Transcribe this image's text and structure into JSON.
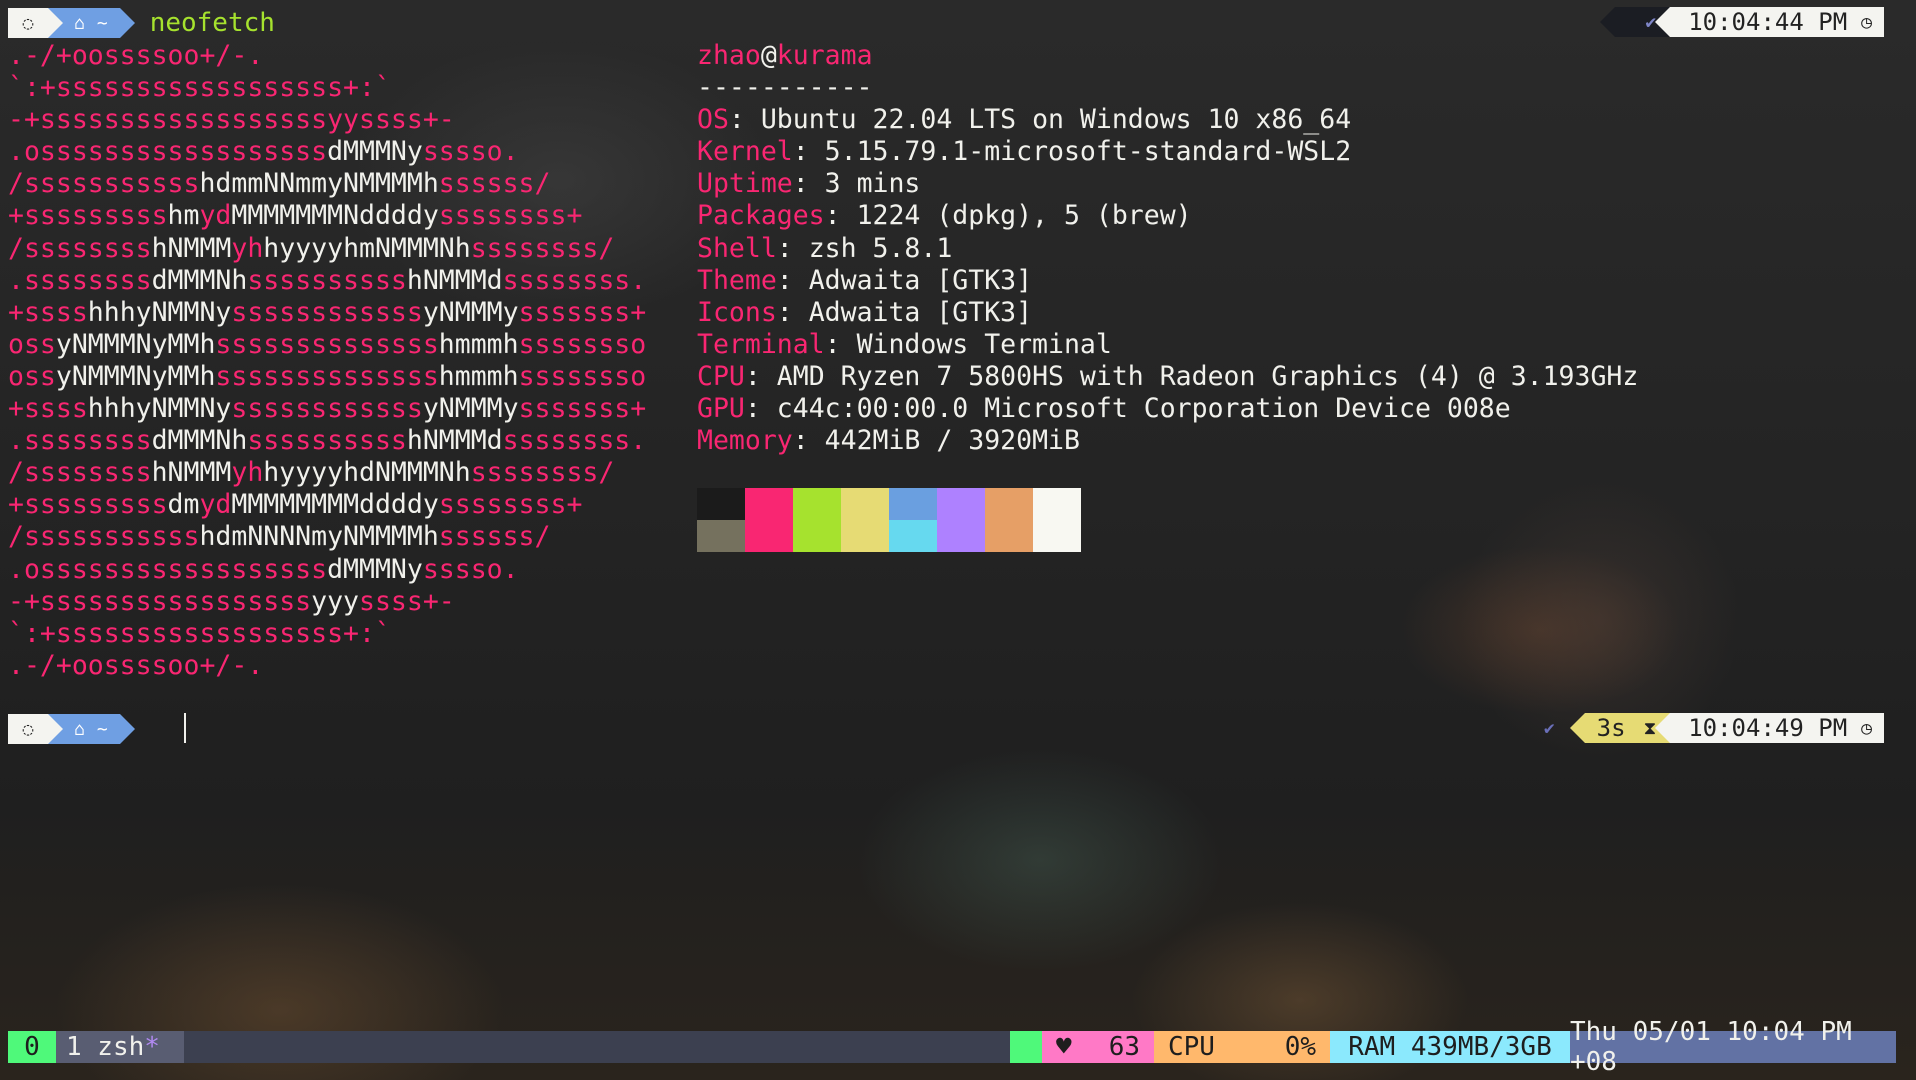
{
  "prompt1": {
    "os_icon": "ubuntu-icon",
    "home_icon": "home-icon",
    "dir": "~",
    "command": "neofetch",
    "status_icon": "check-icon",
    "time": "10:04:44 PM",
    "time_icon": "clock-icon"
  },
  "prompt2": {
    "os_icon": "ubuntu-icon",
    "home_icon": "home-icon",
    "dir": "~",
    "status_icon": "check-icon",
    "duration": "3s",
    "duration_icon": "hourglass-icon",
    "time": "10:04:49 PM",
    "time_icon": "clock-icon"
  },
  "ascii_logo": [
    [
      [
        "p",
        "          .-/+oossssoo+/-."
      ]
    ],
    [
      [
        "p",
        "      `:+ssssssssssssssssss+:`"
      ]
    ],
    [
      [
        "p",
        "    -+ssssssssssssssssssyyssss+-"
      ]
    ],
    [
      [
        "p",
        "  .ossssssssssssssssss"
      ],
      [
        "w",
        "dMMMNy"
      ],
      [
        "p",
        "sssso."
      ]
    ],
    [
      [
        "p",
        " /sssssssssss"
      ],
      [
        "w",
        "hdmmNNmmyNMMMMh"
      ],
      [
        "p",
        "ssssss/"
      ]
    ],
    [
      [
        "p",
        " +sssssssss"
      ],
      [
        "w",
        "hm"
      ],
      [
        "p",
        "yd"
      ],
      [
        "w",
        "MMMMMMMNddddy"
      ],
      [
        "p",
        "ssssssss+"
      ]
    ],
    [
      [
        "p",
        "/ssssssss"
      ],
      [
        "w",
        "hNMMM"
      ],
      [
        "p",
        "yh"
      ],
      [
        "w",
        "hyyyyhmNMMMNh"
      ],
      [
        "p",
        "ssssssss/"
      ]
    ],
    [
      [
        "p",
        ".ssssssss"
      ],
      [
        "w",
        "dMMMNh"
      ],
      [
        "p",
        "ssssssssss"
      ],
      [
        "w",
        "hNMMMd"
      ],
      [
        "p",
        "ssssssss."
      ]
    ],
    [
      [
        "p",
        "+ssss"
      ],
      [
        "w",
        "hhhyNMMNy"
      ],
      [
        "p",
        "ssssssssssss"
      ],
      [
        "w",
        "yNMMMy"
      ],
      [
        "p",
        "sssssss+"
      ]
    ],
    [
      [
        "p",
        "oss"
      ],
      [
        "w",
        "yNMMMNyMMh"
      ],
      [
        "p",
        "ssssssssssssss"
      ],
      [
        "w",
        "hmmmh"
      ],
      [
        "p",
        "ssssssso"
      ]
    ],
    [
      [
        "p",
        "oss"
      ],
      [
        "w",
        "yNMMMNyMMh"
      ],
      [
        "p",
        "ssssssssssssss"
      ],
      [
        "w",
        "hmmmh"
      ],
      [
        "p",
        "ssssssso"
      ]
    ],
    [
      [
        "p",
        "+ssss"
      ],
      [
        "w",
        "hhhyNMMNy"
      ],
      [
        "p",
        "ssssssssssss"
      ],
      [
        "w",
        "yNMMMy"
      ],
      [
        "p",
        "sssssss+"
      ]
    ],
    [
      [
        "p",
        ".ssssssss"
      ],
      [
        "w",
        "dMMMNh"
      ],
      [
        "p",
        "ssssssssss"
      ],
      [
        "w",
        "hNMMMd"
      ],
      [
        "p",
        "ssssssss."
      ]
    ],
    [
      [
        "p",
        "/ssssssss"
      ],
      [
        "w",
        "hNMMM"
      ],
      [
        "p",
        "yh"
      ],
      [
        "w",
        "hyyyyhdNMMMNh"
      ],
      [
        "p",
        "ssssssss/"
      ]
    ],
    [
      [
        "p",
        " +sssssssss"
      ],
      [
        "w",
        "dm"
      ],
      [
        "p",
        "yd"
      ],
      [
        "w",
        "MMMMMMMMddddy"
      ],
      [
        "p",
        "ssssssss+"
      ]
    ],
    [
      [
        "p",
        " /sssssssssss"
      ],
      [
        "w",
        "hdmNNNNmyNMMMMh"
      ],
      [
        "p",
        "ssssss/"
      ]
    ],
    [
      [
        "p",
        "  .ossssssssssssssssss"
      ],
      [
        "w",
        "dMMMNy"
      ],
      [
        "p",
        "sssso."
      ]
    ],
    [
      [
        "p",
        "    -+sssssssssssssssss"
      ],
      [
        "w",
        "yyy"
      ],
      [
        "p",
        "ssss+-"
      ]
    ],
    [
      [
        "p",
        "      `:+ssssssssssssssssss+:`"
      ]
    ],
    [
      [
        "p",
        "          .-/+oossssoo+/-."
      ]
    ]
  ],
  "info": {
    "user": "zhao",
    "at": "@",
    "host": "kurama",
    "separator": "-----------",
    "rows": [
      {
        "key": "OS",
        "value": "Ubuntu 22.04 LTS on Windows 10 x86_64"
      },
      {
        "key": "Kernel",
        "value": "5.15.79.1-microsoft-standard-WSL2"
      },
      {
        "key": "Uptime",
        "value": "3 mins"
      },
      {
        "key": "Packages",
        "value": "1224 (dpkg), 5 (brew)"
      },
      {
        "key": "Shell",
        "value": "zsh 5.8.1"
      },
      {
        "key": "Theme",
        "value": "Adwaita [GTK3]"
      },
      {
        "key": "Icons",
        "value": "Adwaita [GTK3]"
      },
      {
        "key": "Terminal",
        "value": "Windows Terminal"
      },
      {
        "key": "CPU",
        "value": "AMD Ryzen 7 5800HS with Radeon Graphics (4) @ 3.193GHz"
      },
      {
        "key": "GPU",
        "value": "c44c:00:00.0 Microsoft Corporation Device 008e"
      },
      {
        "key": "Memory",
        "value": "442MiB / 3920MiB"
      }
    ]
  },
  "palette": {
    "top": [
      "#1b1b1b",
      "#f92672",
      "#a6e22e",
      "#e6db74",
      "#6a9fe0",
      "#ae81ff",
      "#e69f66",
      "#f8f8f2"
    ],
    "bottom": [
      "#75715e",
      "#f92672",
      "#a6e22e",
      "#e6db74",
      "#66d9ef",
      "#ae81ff",
      "#e69f66",
      "#f8f8f2"
    ]
  },
  "colors": {
    "pink": "#f92672",
    "green": "#a6e22e",
    "yellow": "#e6db74",
    "blue": "#6f9fe3",
    "foreground": "#f1f1ec"
  },
  "status_bar": {
    "window_index": "0",
    "window_name": "1 zsh",
    "window_flag": "*",
    "heart_icon": "heart-icon",
    "heart_value": "63",
    "cpu_label": "CPU",
    "cpu_value": "0%",
    "ram": "RAM 439MB/3GB",
    "datetime": "Thu 05/01 10:04 PM +08"
  }
}
